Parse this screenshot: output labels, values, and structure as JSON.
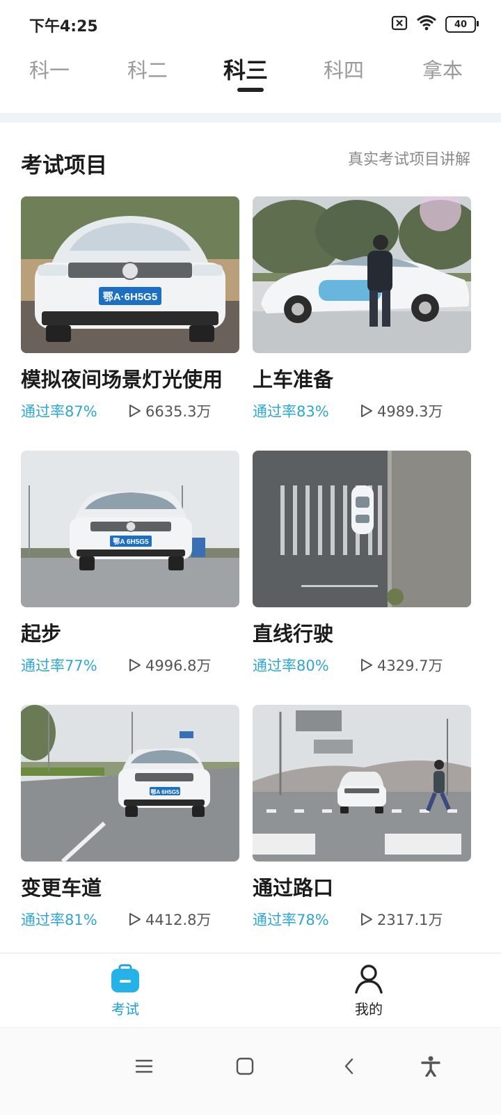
{
  "status_bar": {
    "time": "下午4:25",
    "battery": "40",
    "icons": [
      "sim-off-icon",
      "wifi-icon",
      "battery-icon"
    ]
  },
  "tabs": [
    {
      "label": "科一",
      "active": false
    },
    {
      "label": "科二",
      "active": false
    },
    {
      "label": "科三",
      "active": true
    },
    {
      "label": "科四",
      "active": false
    },
    {
      "label": "拿本",
      "active": false
    }
  ],
  "section": {
    "title": "考试项目",
    "link": "真实考试项目讲解"
  },
  "items": [
    {
      "title": "模拟夜间场景灯光使用",
      "pass_rate": "通过率87%",
      "views": "6635.3万",
      "plate": "鄂A·6H5G5"
    },
    {
      "title": "上车准备",
      "pass_rate": "通过率83%",
      "views": "4989.3万"
    },
    {
      "title": "起步",
      "pass_rate": "通过率77%",
      "views": "4996.8万",
      "plate": "鄂A 6H5G5"
    },
    {
      "title": "直线行驶",
      "pass_rate": "通过率80%",
      "views": "4329.7万"
    },
    {
      "title": "变更车道",
      "pass_rate": "通过率81%",
      "views": "4412.8万",
      "plate": "鄂A 6H5G5"
    },
    {
      "title": "通过路口",
      "pass_rate": "通过率78%",
      "views": "2317.1万"
    }
  ],
  "bottom_nav": [
    {
      "label": "考试",
      "icon": "exam-briefcase-icon",
      "active": true
    },
    {
      "label": "我的",
      "icon": "person-icon",
      "active": false
    }
  ],
  "system_nav": [
    "menu-icon",
    "home-square-icon",
    "back-chevron-icon",
    "accessibility-icon"
  ],
  "colors": {
    "accent": "#2fa6cf",
    "nav_active": "#1a9fd2",
    "band": "#eef4f6"
  }
}
